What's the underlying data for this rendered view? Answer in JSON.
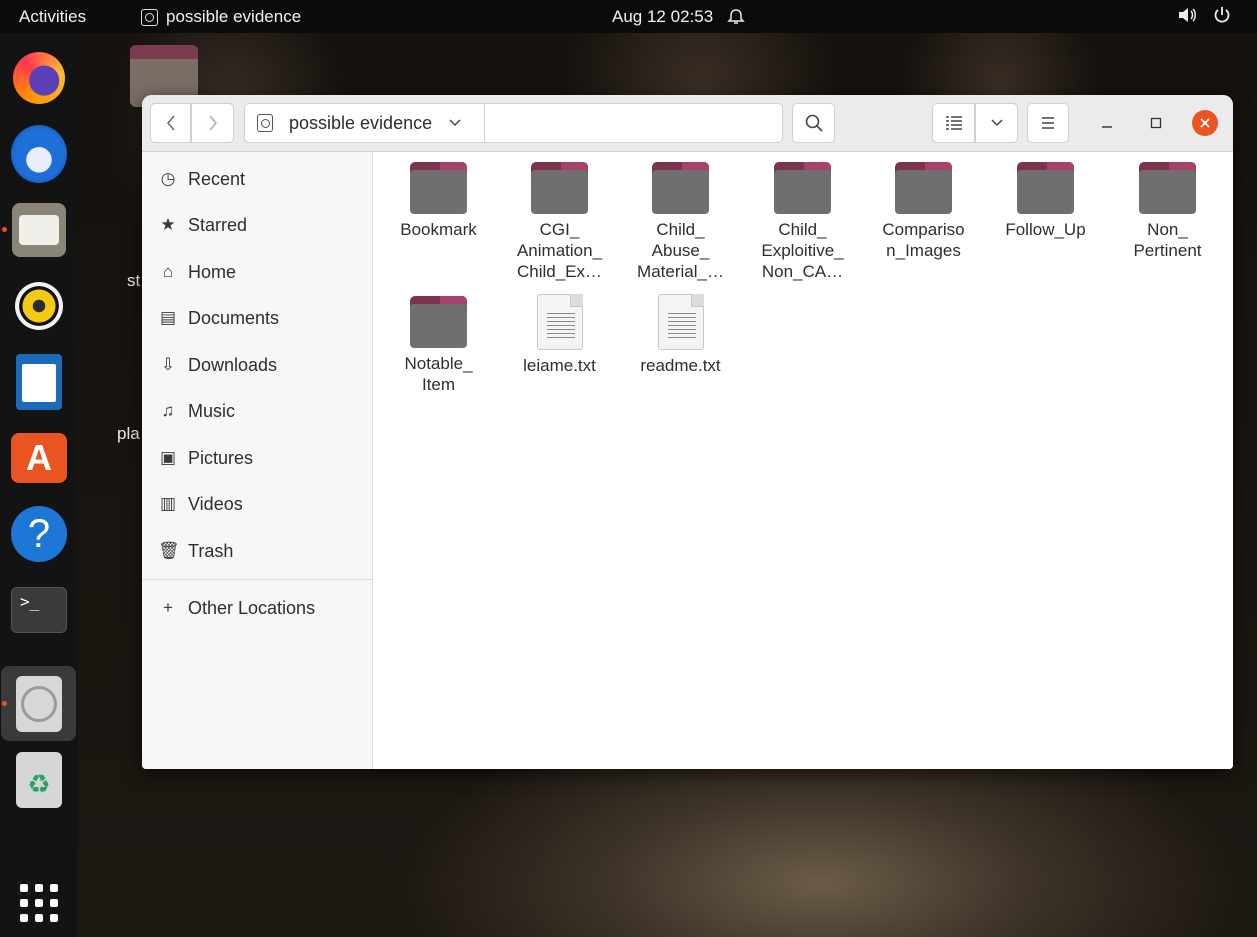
{
  "topbar": {
    "activities": "Activities",
    "app_name": "possible evidence",
    "date": "Aug 12",
    "time": "02:53",
    "icons": [
      "bell-icon",
      "volume-icon",
      "power-icon"
    ]
  },
  "dock": {
    "items": [
      "firefox",
      "thunderbird",
      "files",
      "rhythmbox",
      "libreoffice-writer",
      "app-center",
      "help",
      "terminal",
      "disc-image",
      "trash"
    ],
    "show_apps": "grid-icon",
    "accent": "#e95420"
  },
  "desktop": {
    "labels": [
      "st",
      "pla"
    ]
  },
  "window": {
    "path_segment": "possible evidence",
    "sidebar": {
      "items": [
        {
          "label": "Recent",
          "icon": "clock-icon"
        },
        {
          "label": "Starred",
          "icon": "star-icon"
        },
        {
          "label": "Home",
          "icon": "home-icon"
        },
        {
          "label": "Documents",
          "icon": "document-icon"
        },
        {
          "label": "Downloads",
          "icon": "download-icon"
        },
        {
          "label": "Music",
          "icon": "music-icon"
        },
        {
          "label": "Pictures",
          "icon": "picture-icon"
        },
        {
          "label": "Videos",
          "icon": "video-icon"
        },
        {
          "label": "Trash",
          "icon": "trash-icon"
        }
      ],
      "other_locations": "Other Locations"
    },
    "files": [
      {
        "label": "Bookmark",
        "type": "folder"
      },
      {
        "label": "CGI_\nAnimation_\nChild_Ex…",
        "type": "folder"
      },
      {
        "label": "Child_\nAbuse_\nMaterial_…",
        "type": "folder"
      },
      {
        "label": "Child_\nExploitive_\nNon_CA…",
        "type": "folder"
      },
      {
        "label": "Compariso\nn_Images",
        "type": "folder"
      },
      {
        "label": "Follow_Up",
        "type": "folder"
      },
      {
        "label": "Non_\nPertinent",
        "type": "folder"
      },
      {
        "label": "Notable_\nItem",
        "type": "folder"
      },
      {
        "label": "leiame.txt",
        "type": "text"
      },
      {
        "label": "readme.txt",
        "type": "text"
      }
    ]
  }
}
